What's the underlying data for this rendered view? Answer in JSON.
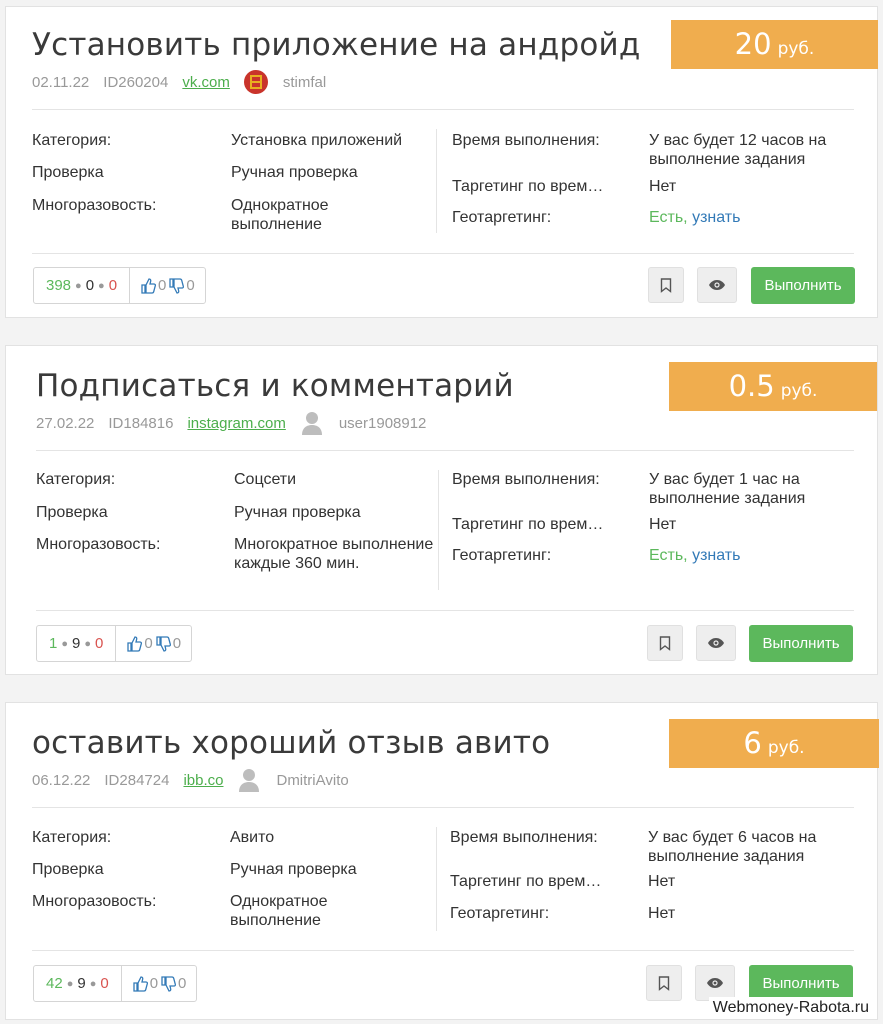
{
  "labels": {
    "category": "Категория:",
    "check": "Проверка",
    "repeat": "Многоразовость:",
    "time": "Время выполнения:",
    "time_target": "Таргетинг по врем…",
    "geo": "Геотаргетинг:",
    "execute": "Выполнить",
    "currency": "руб."
  },
  "tasks": [
    {
      "title": "Установить приложение на андройд",
      "price": "20",
      "date": "02.11.22",
      "id": "ID260204",
      "site": "vk.com",
      "user": "stimfal",
      "avatar": "flag-avatar",
      "category": "Установка приложений",
      "check": "Ручная проверка",
      "repeat": "Однократное выполнение",
      "time": "У вас будет 12 часов на выполнение задания",
      "time_target": "Нет",
      "geo": "Есть,",
      "geo_link": "узнать",
      "stat_a": "398",
      "stat_b": "0",
      "stat_c": "0",
      "likes": "0",
      "dislikes": "0"
    },
    {
      "title": "Подписаться и комментарий",
      "price": "0.5",
      "date": "27.02.22",
      "id": "ID184816",
      "site": "instagram.com",
      "user": "user1908912",
      "avatar": "default-user-avatar",
      "category": "Соцсети",
      "check": "Ручная проверка",
      "repeat": "Многократное выполнение каждые 360 мин.",
      "time": "У вас будет 1 час на выполнение задания",
      "time_target": "Нет",
      "geo": "Есть,",
      "geo_link": "узнать",
      "stat_a": "1",
      "stat_b": "9",
      "stat_c": "0",
      "likes": "0",
      "dislikes": "0"
    },
    {
      "title": "оставить хороший отзыв авито",
      "price": "6",
      "date": "06.12.22",
      "id": "ID284724",
      "site": "ibb.co",
      "user": "DmitriAvito",
      "avatar": "default-user-avatar",
      "category": "Авито",
      "check": "Ручная проверка",
      "repeat": "Однократное выполнение",
      "time": "У вас будет 6 часов на выполнение задания",
      "time_target": "Нет",
      "geo": "Нет",
      "geo_link": "",
      "stat_a": "42",
      "stat_b": "9",
      "stat_c": "0",
      "likes": "0",
      "dislikes": "0"
    }
  ],
  "watermark": "Webmoney-Rabota.ru",
  "colors": {
    "price_bg": "#f0ad4e",
    "execute_bg": "#5cb85c",
    "link_green": "#4cae4c",
    "link_blue": "#337ab7"
  }
}
